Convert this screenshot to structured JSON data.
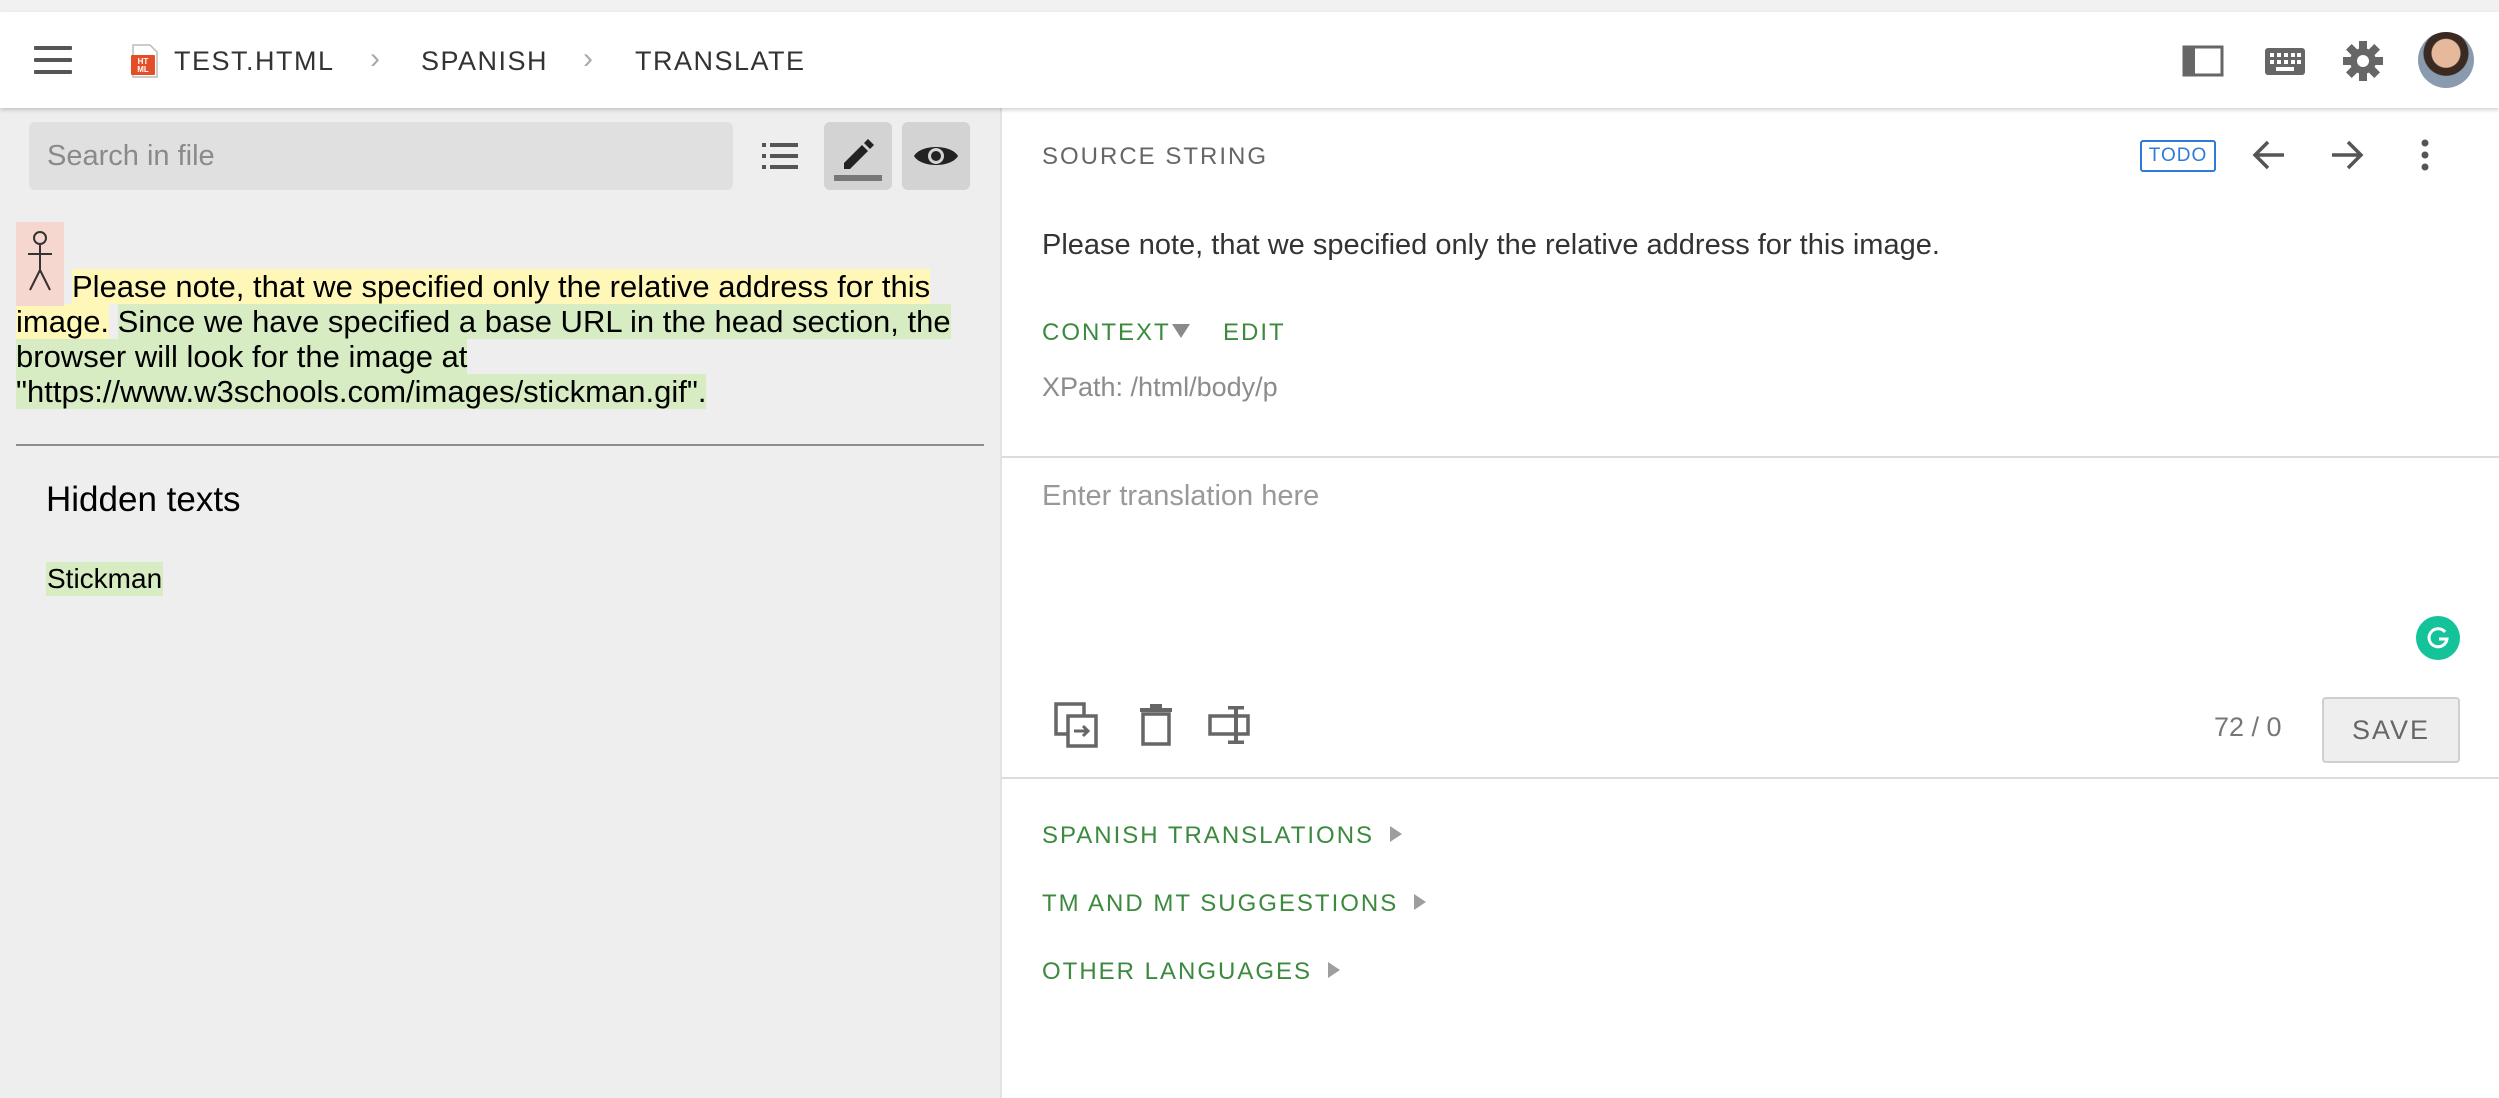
{
  "header": {
    "breadcrumbs": [
      "TEST.HTML",
      "SPANISH",
      "TRANSLATE"
    ],
    "file_icon_text": "HTML",
    "icons": [
      "menu-icon",
      "html-file-icon",
      "chevron-right-icon",
      "sidebar-toggle-icon",
      "keyboard-icon",
      "gear-icon",
      "avatar"
    ]
  },
  "left": {
    "search_placeholder": "Search in file",
    "tools": [
      "list-icon",
      "edit-icon",
      "eye-icon"
    ],
    "preview": {
      "segment_1": "Please note, that we specified only the relative address for this image.",
      "segment_2": "Since we have specified a base URL in the head section, the browser will look for the image at \"https://www.w3schools.com/images/stickman.gif\"."
    },
    "hidden_title": "Hidden texts",
    "hidden_items": [
      "Stickman"
    ]
  },
  "right": {
    "source_label": "SOURCE STRING",
    "status": "TODO",
    "source_text": "Please note, that we specified only the relative address for this image.",
    "context_label": "CONTEXT",
    "edit_label": "EDIT",
    "xpath": "XPath: /html/body/p",
    "translation_placeholder": "Enter translation here",
    "counter": "72 / 0",
    "save_label": "SAVE",
    "sections": [
      "SPANISH TRANSLATIONS",
      "TM AND MT SUGGESTIONS",
      "OTHER LANGUAGES"
    ]
  },
  "colors": {
    "accent_green": "#3b8a3e",
    "todo_blue": "#2e7bd6",
    "highlight_yellow": "#fff7b8",
    "highlight_green": "#d7ecc3",
    "grammarly": "#15c39a"
  }
}
